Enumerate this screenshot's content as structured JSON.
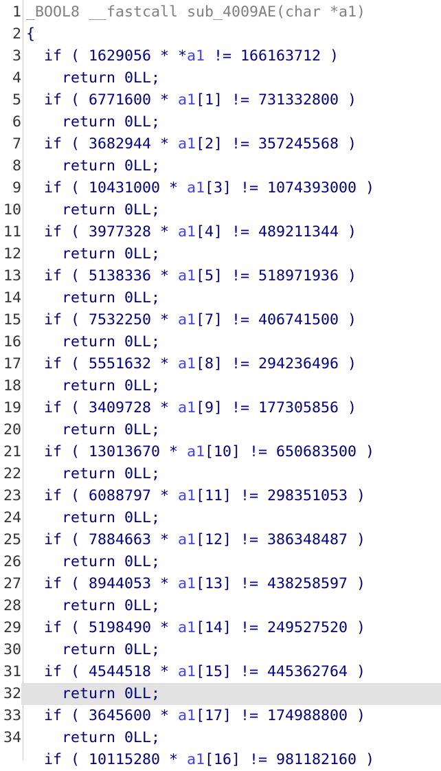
{
  "editor": {
    "current_line": 32,
    "lines": [
      {
        "n": "1",
        "segs": [
          {
            "t": "_BOOL8 __fastcall sub_4009AE(char *a1)",
            "c": "gray"
          }
        ]
      },
      {
        "n": "2",
        "segs": [
          {
            "t": "{",
            "c": "kw"
          }
        ]
      },
      {
        "n": "3",
        "segs": [
          {
            "t": "  if ( 1629056 * *",
            "c": "kw"
          },
          {
            "t": "a1",
            "c": "var"
          },
          {
            "t": " != 166163712 )",
            "c": "kw"
          }
        ]
      },
      {
        "n": "4",
        "segs": [
          {
            "t": "    return 0LL;",
            "c": "kw"
          }
        ]
      },
      {
        "n": "5",
        "segs": [
          {
            "t": "  if ( 6771600 * ",
            "c": "kw"
          },
          {
            "t": "a1",
            "c": "var"
          },
          {
            "t": "[1] != 731332800 )",
            "c": "kw"
          }
        ]
      },
      {
        "n": "6",
        "segs": [
          {
            "t": "    return 0LL;",
            "c": "kw"
          }
        ]
      },
      {
        "n": "7",
        "segs": [
          {
            "t": "  if ( 3682944 * ",
            "c": "kw"
          },
          {
            "t": "a1",
            "c": "var"
          },
          {
            "t": "[2] != 357245568 )",
            "c": "kw"
          }
        ]
      },
      {
        "n": "8",
        "segs": [
          {
            "t": "    return 0LL;",
            "c": "kw"
          }
        ]
      },
      {
        "n": "9",
        "segs": [
          {
            "t": "  if ( 10431000 * ",
            "c": "kw"
          },
          {
            "t": "a1",
            "c": "var"
          },
          {
            "t": "[3] != 1074393000 )",
            "c": "kw"
          }
        ]
      },
      {
        "n": "10",
        "segs": [
          {
            "t": "    return 0LL;",
            "c": "kw"
          }
        ]
      },
      {
        "n": "11",
        "segs": [
          {
            "t": "  if ( 3977328 * ",
            "c": "kw"
          },
          {
            "t": "a1",
            "c": "var"
          },
          {
            "t": "[4] != 489211344 )",
            "c": "kw"
          }
        ]
      },
      {
        "n": "12",
        "segs": [
          {
            "t": "    return 0LL;",
            "c": "kw"
          }
        ]
      },
      {
        "n": "13",
        "segs": [
          {
            "t": "  if ( 5138336 * ",
            "c": "kw"
          },
          {
            "t": "a1",
            "c": "var"
          },
          {
            "t": "[5] != 518971936 )",
            "c": "kw"
          }
        ]
      },
      {
        "n": "14",
        "segs": [
          {
            "t": "    return 0LL;",
            "c": "kw"
          }
        ]
      },
      {
        "n": "15",
        "segs": [
          {
            "t": "  if ( 7532250 * ",
            "c": "kw"
          },
          {
            "t": "a1",
            "c": "var"
          },
          {
            "t": "[7] != 406741500 )",
            "c": "kw"
          }
        ]
      },
      {
        "n": "16",
        "segs": [
          {
            "t": "    return 0LL;",
            "c": "kw"
          }
        ]
      },
      {
        "n": "17",
        "segs": [
          {
            "t": "  if ( 5551632 * ",
            "c": "kw"
          },
          {
            "t": "a1",
            "c": "var"
          },
          {
            "t": "[8] != 294236496 )",
            "c": "kw"
          }
        ]
      },
      {
        "n": "18",
        "segs": [
          {
            "t": "    return 0LL;",
            "c": "kw"
          }
        ]
      },
      {
        "n": "19",
        "segs": [
          {
            "t": "  if ( 3409728 * ",
            "c": "kw"
          },
          {
            "t": "a1",
            "c": "var"
          },
          {
            "t": "[9] != 177305856 )",
            "c": "kw"
          }
        ]
      },
      {
        "n": "20",
        "segs": [
          {
            "t": "    return 0LL;",
            "c": "kw"
          }
        ]
      },
      {
        "n": "21",
        "segs": [
          {
            "t": "  if ( 13013670 * ",
            "c": "kw"
          },
          {
            "t": "a1",
            "c": "var"
          },
          {
            "t": "[10] != 650683500 )",
            "c": "kw"
          }
        ]
      },
      {
        "n": "22",
        "segs": [
          {
            "t": "    return 0LL;",
            "c": "kw"
          }
        ]
      },
      {
        "n": "23",
        "segs": [
          {
            "t": "  if ( 6088797 * ",
            "c": "kw"
          },
          {
            "t": "a1",
            "c": "var"
          },
          {
            "t": "[11] != 298351053 )",
            "c": "kw"
          }
        ]
      },
      {
        "n": "24",
        "segs": [
          {
            "t": "    return 0LL;",
            "c": "kw"
          }
        ]
      },
      {
        "n": "25",
        "segs": [
          {
            "t": "  if ( 7884663 * ",
            "c": "kw"
          },
          {
            "t": "a1",
            "c": "var"
          },
          {
            "t": "[12] != 386348487 )",
            "c": "kw"
          }
        ]
      },
      {
        "n": "26",
        "segs": [
          {
            "t": "    return 0LL;",
            "c": "kw"
          }
        ]
      },
      {
        "n": "27",
        "segs": [
          {
            "t": "  if ( 8944053 * ",
            "c": "kw"
          },
          {
            "t": "a1",
            "c": "var"
          },
          {
            "t": "[13] != 438258597 )",
            "c": "kw"
          }
        ]
      },
      {
        "n": "28",
        "segs": [
          {
            "t": "    return 0LL;",
            "c": "kw"
          }
        ]
      },
      {
        "n": "29",
        "segs": [
          {
            "t": "  if ( 5198490 * ",
            "c": "kw"
          },
          {
            "t": "a1",
            "c": "var"
          },
          {
            "t": "[14] != 249527520 )",
            "c": "kw"
          }
        ]
      },
      {
        "n": "30",
        "segs": [
          {
            "t": "    return 0LL;",
            "c": "kw"
          }
        ]
      },
      {
        "n": "31",
        "segs": [
          {
            "t": "  if ( 4544518 * ",
            "c": "kw"
          },
          {
            "t": "a1",
            "c": "var"
          },
          {
            "t": "[15] != 445362764 )",
            "c": "kw"
          }
        ]
      },
      {
        "n": "32",
        "segs": [
          {
            "t": "    return 0LL;",
            "c": "kw"
          }
        ]
      },
      {
        "n": "33",
        "segs": [
          {
            "t": "  if ( 3645600 * ",
            "c": "kw"
          },
          {
            "t": "a1",
            "c": "var"
          },
          {
            "t": "[17] != 174988800 )",
            "c": "kw"
          }
        ]
      },
      {
        "n": "34",
        "segs": [
          {
            "t": "    return 0LL;",
            "c": "kw"
          }
        ]
      },
      {
        "n": "",
        "segs": [
          {
            "t": "  if ( 10115280 * ",
            "c": "kw"
          },
          {
            "t": "a1",
            "c": "var"
          },
          {
            "t": "[16] != 981182160 )",
            "c": "kw"
          }
        ]
      }
    ]
  }
}
